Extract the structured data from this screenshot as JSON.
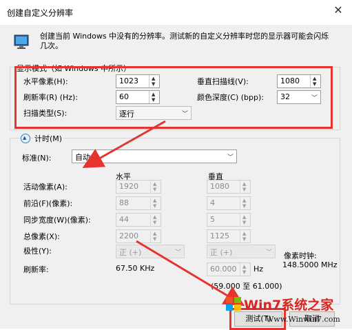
{
  "window": {
    "title": "创建自定义分辨率"
  },
  "notice": "创建当前 Windows 中没有的分辨率。测试新的自定义分辨率时您的显示器可能会闪烁几次。",
  "display_mode": {
    "legend": "显示模式（如 Windows 中所示）",
    "h_pixels": {
      "label": "水平像素(H):",
      "value": "1023"
    },
    "v_lines": {
      "label": "垂直扫描线(V):",
      "value": "1080"
    },
    "refresh": {
      "label": "刷新率(R) (Hz):",
      "value": "60"
    },
    "color_depth": {
      "label": "颜色深度(C) (bpp):",
      "value": "32"
    },
    "scan_type": {
      "label": "扫描类型(S):",
      "value": "逐行"
    }
  },
  "timing": {
    "toggle_label": "计时(M)",
    "standard_label": "标准(N):",
    "standard_value": "自动",
    "col_horizontal": "水平",
    "col_vertical": "垂直",
    "rows": [
      {
        "label": "活动像素(A):",
        "h": "1920",
        "v": "1080"
      },
      {
        "label": "前沿(F)(像素):",
        "h": "88",
        "v": "4"
      },
      {
        "label": "同步宽度(W)(像素):",
        "h": "44",
        "v": "5"
      },
      {
        "label": "总像素(X):",
        "h": "2200",
        "v": "1125"
      }
    ],
    "polarity": {
      "label": "极性(Y):",
      "h": "正 (+)",
      "v": "正 (+)"
    },
    "pixel_clock": {
      "label": "像素时钟:",
      "value": "148.5000 MHz"
    },
    "refresh_rate": {
      "label": "刷新率:",
      "h_value": "67.50 KHz",
      "v_value": "60.000",
      "unit": "Hz",
      "range": "(59.000 至 61.000)"
    }
  },
  "buttons": {
    "test": "测试(T)",
    "cancel": "取消"
  },
  "watermark": {
    "text": "Win7系统之家",
    "url": "Www.Winwin7.com"
  },
  "colors": {
    "accent_red": "#e53330",
    "watermark_red": "#d9251d"
  }
}
